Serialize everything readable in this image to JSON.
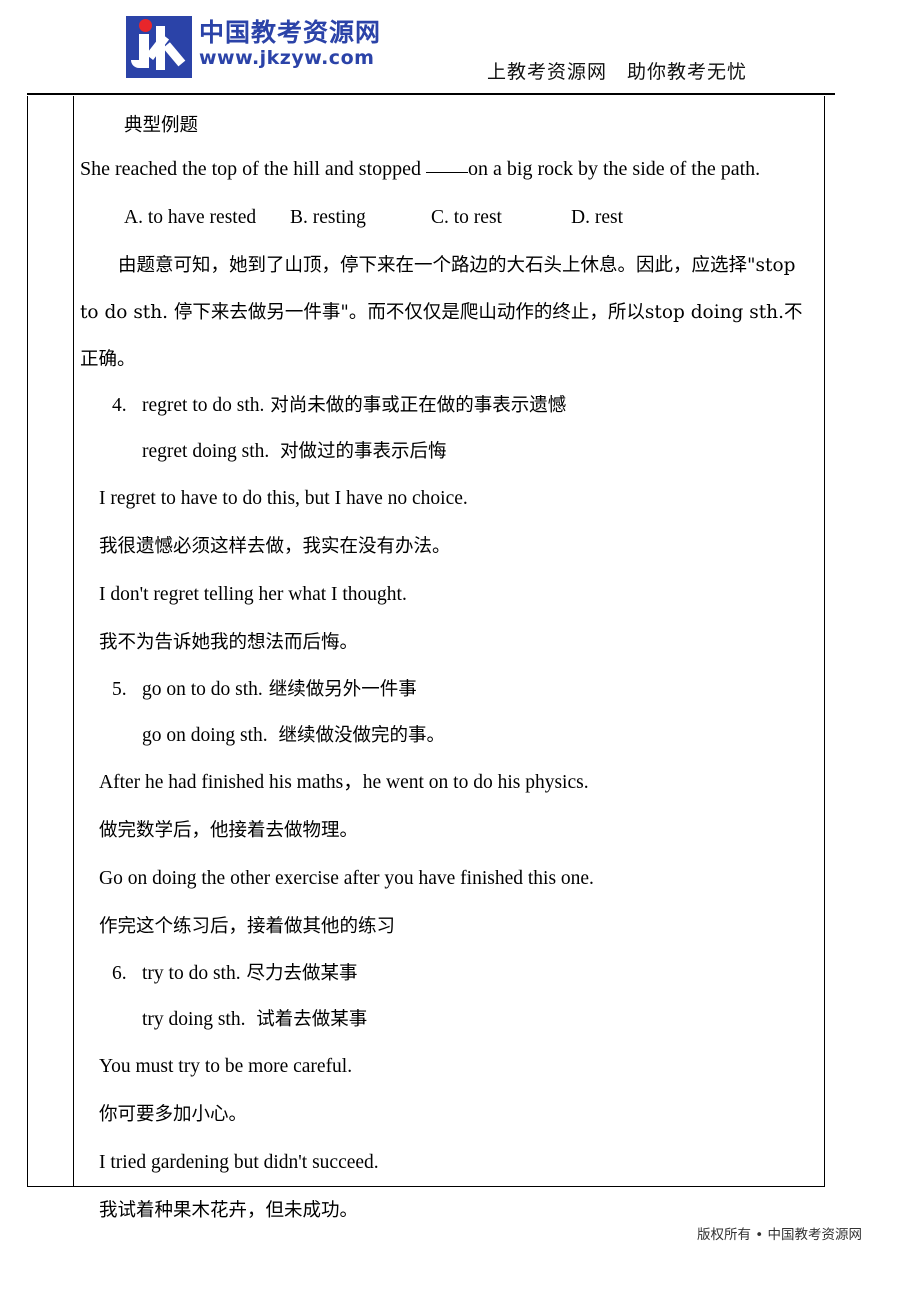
{
  "header": {
    "logo_cn": "中国教考资源网",
    "logo_url": "www.jkzyw.com",
    "logo_letters": "jk",
    "slogan": "上教考资源网　助你教考无忧"
  },
  "content": {
    "section_title": "典型例题",
    "question": {
      "before_blank": "She reached the top of the hill and stopped ",
      "after_blank": "on a big rock by the side of the path."
    },
    "options": [
      "A. to have rested",
      "B. resting",
      "C. to rest",
      "D. rest"
    ],
    "explanation": "由题意可知，她到了山顶，停下来在一个路边的大石头上休息。因此，应选择\"stop to do sth. 停下来去做另一件事\"。而不仅仅是爬山动作的终止，所以stop doing sth.不正确。",
    "rules": [
      {
        "number": "4.",
        "head_en": "regret to do sth.",
        "head_cn": "对尚未做的事或正在做的事表示遗憾",
        "sub_en": "regret doing sth.",
        "sub_cn": "对做过的事表示后悔",
        "examples": [
          {
            "en": "I regret to have to do this, but I have no choice.",
            "cn": "我很遗憾必须这样去做，我实在没有办法。"
          },
          {
            "en": "I don't regret telling her what I thought.",
            "cn": "我不为告诉她我的想法而后悔。"
          }
        ]
      },
      {
        "number": "5.",
        "head_en": "go on to do sth.",
        "head_cn": "继续做另外一件事",
        "sub_en": "go on doing sth.",
        "sub_cn": "继续做没做完的事。",
        "examples": [
          {
            "en": "After he had finished his maths，he went on to do his physics.",
            "cn": "做完数学后，他接着去做物理。"
          },
          {
            "en": "Go on doing the other exercise after you have finished this one.",
            "cn": "作完这个练习后，接着做其他的练习"
          }
        ]
      },
      {
        "number": "6.",
        "head_en": "try to do sth.",
        "head_cn": "尽力去做某事",
        "sub_en": "try doing sth.",
        "sub_cn": "试着去做某事",
        "examples": [
          {
            "en": "You must try to be more careful.",
            "cn": "你可要多加小心。"
          },
          {
            "en": "I tried gardening but didn't succeed.",
            "cn": "我试着种果木花卉，但未成功。"
          }
        ]
      }
    ]
  },
  "footer": {
    "copyright": "版权所有 • 中国教考资源网"
  },
  "colors": {
    "brand_blue": "#2b43a8",
    "accent_red": "#e8262b",
    "text": "#000000"
  }
}
